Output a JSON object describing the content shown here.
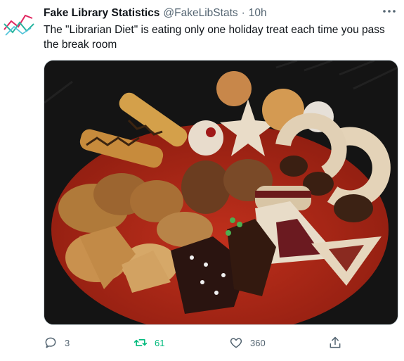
{
  "tweet": {
    "display_name": "Fake Library Statistics",
    "handle": "@FakeLibStats",
    "separator": "·",
    "time": "10h",
    "text": "The \"Librarian Diet\" is eating only one holiday treat each time you pass the break room",
    "avatar_icon": "line-chart-logo-icon",
    "more_icon": "more-horizontal-icon",
    "media_description_icon": "cookie-platter-photo"
  },
  "actions": {
    "reply": {
      "icon": "reply-icon",
      "count": "3"
    },
    "retweet": {
      "icon": "retweet-icon",
      "count": "61",
      "active": true,
      "color": "#00ba7c"
    },
    "like": {
      "icon": "heart-icon",
      "count": "360"
    },
    "share": {
      "icon": "share-icon"
    }
  },
  "colors": {
    "text_primary": "#0f1419",
    "text_secondary": "#536471",
    "retweet_active": "#00ba7c",
    "avatar_red": "#e0245e",
    "avatar_teal": "#17bf63"
  }
}
